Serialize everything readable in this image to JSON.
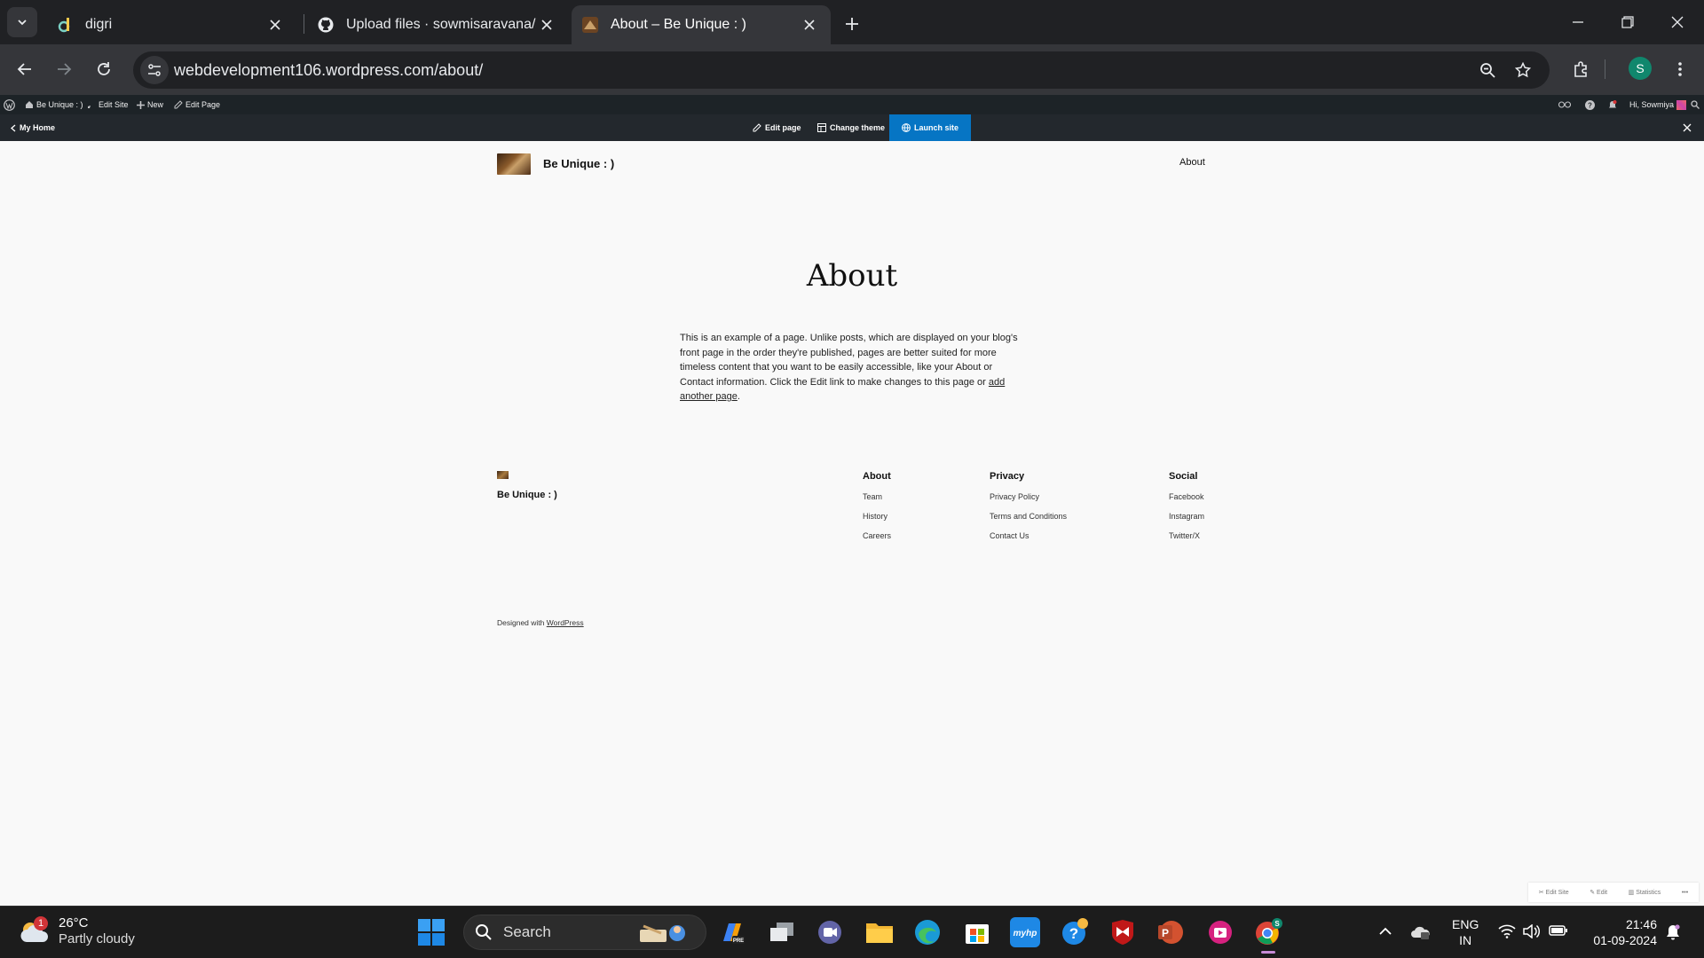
{
  "browser": {
    "tabs": [
      {
        "title": "digri",
        "active": false,
        "icon": "digri-favicon"
      },
      {
        "title": "Upload files · sowmisaravana/sc",
        "active": false,
        "icon": "github-icon"
      },
      {
        "title": "About – Be Unique : )",
        "active": true,
        "icon": "site-logo-favicon"
      }
    ],
    "url": "webdevelopment106.wordpress.com/about/",
    "profile_initial": "S"
  },
  "admin_bar": {
    "site_name": "Be Unique : )",
    "edit_site": "Edit Site",
    "new": "New",
    "edit_page": "Edit Page",
    "greeting": "Hi, Sowmiya"
  },
  "launch_bar": {
    "my_home": "My Home",
    "edit_page": "Edit page",
    "change_theme": "Change theme",
    "launch_site": "Launch site",
    "accent": "#0675c4"
  },
  "site": {
    "title": "Be Unique : )",
    "nav": [
      "About"
    ],
    "page_title": "About",
    "body_text": "This is an example of a page. Unlike posts, which are displayed on your blog's front page in the order they're published, pages are better suited for more timeless content that you want to be easily accessible, like your About or Contact information. Click the Edit link to make changes to this page or ",
    "body_link": "add another page",
    "body_end": ".",
    "footer": {
      "title": "Be Unique : )",
      "columns": [
        {
          "heading": "About",
          "links": [
            "Team",
            "History",
            "Careers"
          ]
        },
        {
          "heading": "Privacy",
          "links": [
            "Privacy Policy",
            "Terms and Conditions",
            "Contact Us"
          ]
        },
        {
          "heading": "Social",
          "links": [
            "Facebook",
            "Instagram",
            "Twitter/X"
          ]
        }
      ],
      "credit_prefix": "Designed with ",
      "credit_link": "WordPress"
    },
    "corner_tools": [
      "Edit Site",
      "Edit",
      "Statistics"
    ]
  },
  "taskbar": {
    "weather_temp": "26°C",
    "weather_cond": "Partly cloudy",
    "weather_badge": "1",
    "search_label": "Search",
    "lang_line1": "ENG",
    "lang_line2": "IN",
    "time": "21:46",
    "date": "01-09-2024"
  }
}
